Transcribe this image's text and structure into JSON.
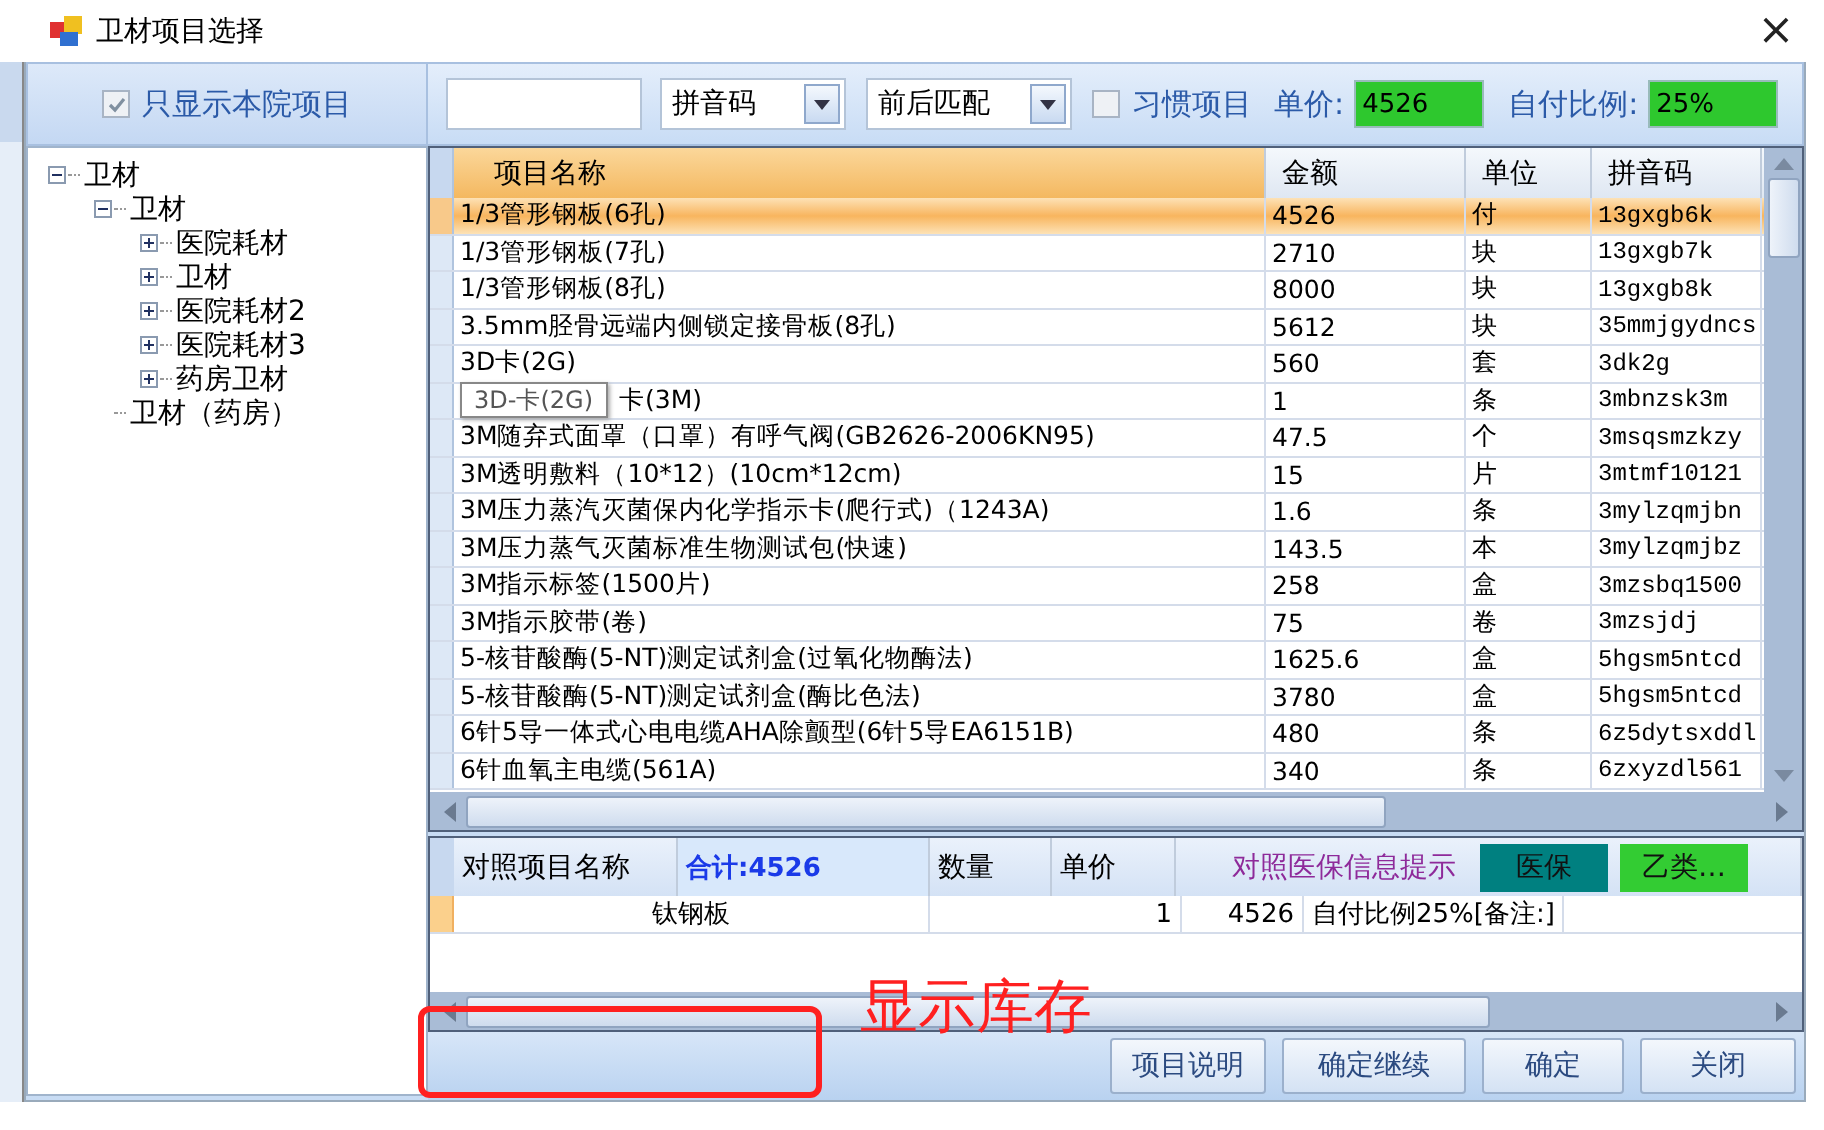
{
  "window": {
    "title": "卫材项目选择",
    "close": "×"
  },
  "filter": {
    "label": "只显示本院项目",
    "checked": true
  },
  "tree": [
    {
      "label": "卫材",
      "kind": "folder",
      "expanded": true,
      "children": [
        {
          "label": "卫材",
          "kind": "folder",
          "expanded": true,
          "children": [
            {
              "label": "医院耗材",
              "kind": "folder",
              "expanded": false
            },
            {
              "label": "卫材",
              "kind": "folder",
              "expanded": false
            },
            {
              "label": "医院耗材2",
              "kind": "folder",
              "expanded": false
            },
            {
              "label": "医院耗材3",
              "kind": "folder",
              "expanded": false
            },
            {
              "label": "药房卫材",
              "kind": "folder",
              "expanded": false
            }
          ]
        },
        {
          "label": "卫材（药房）",
          "kind": "leaf"
        }
      ]
    }
  ],
  "toolbar": {
    "search_mode": {
      "value": "拼音码"
    },
    "match_mode": {
      "value": "前后匹配"
    },
    "habit": {
      "label": "习惯项目",
      "checked": false
    },
    "price": {
      "label": "单价:",
      "value": "4526"
    },
    "ratio": {
      "label": "自付比例:",
      "value": "25%"
    }
  },
  "table": {
    "columns": [
      "项目名称",
      "金额",
      "单位",
      "拼音码"
    ],
    "rows": [
      {
        "cells": [
          "1/3管形钢板(6孔)",
          "4526",
          "付",
          "13gxgb6k"
        ],
        "selected": true
      },
      {
        "cells": [
          "1/3管形钢板(7孔)",
          "2710",
          "块",
          "13gxgb7k"
        ],
        "selected": false
      },
      {
        "cells": [
          "1/3管形钢板(8孔)",
          "8000",
          "块",
          "13gxgb8k"
        ],
        "selected": false
      },
      {
        "cells": [
          "3.5mm胫骨远端内侧锁定接骨板(8孔)",
          "5612",
          "块",
          "35mmjgydncs"
        ],
        "selected": false
      },
      {
        "cells": [
          "3D卡(2G)",
          "560",
          "套",
          "3dk2g"
        ],
        "selected": false
      },
      {
        "cells": [
          "卡(3M)",
          "1",
          "条",
          "3mbnzsk3m"
        ],
        "selected": false,
        "tooltip": "3D-卡(2G)"
      },
      {
        "cells": [
          "3M随弃式面罩（口罩）有呼气阀(GB2626-2006KN95)",
          "47.5",
          "个",
          "3msqsmzkzy"
        ],
        "selected": false
      },
      {
        "cells": [
          "3M透明敷料（10*12）(10cm*12cm)",
          "15",
          "片",
          "3mtmf10121"
        ],
        "selected": false
      },
      {
        "cells": [
          "3M压力蒸汽灭菌保内化学指示卡(爬行式)（1243A)",
          "1.6",
          "条",
          "3mylzqmjbn"
        ],
        "selected": false
      },
      {
        "cells": [
          "3M压力蒸气灭菌标准生物测试包(快速)",
          "143.5",
          "本",
          "3mylzqmjbz"
        ],
        "selected": false
      },
      {
        "cells": [
          "3M指示标签(1500片)",
          "258",
          "盒",
          "3mzsbq1500"
        ],
        "selected": false
      },
      {
        "cells": [
          "3M指示胶带(卷)",
          "75",
          "卷",
          "3mzsjdj"
        ],
        "selected": false
      },
      {
        "cells": [
          "5-核苷酸酶(5-NT)测定试剂盒(过氧化物酶法)",
          "1625.6",
          "盒",
          "5hgsm5ntcd"
        ],
        "selected": false
      },
      {
        "cells": [
          "5-核苷酸酶(5-NT)测定试剂盒(酶比色法)",
          "3780",
          "盒",
          "5hgsm5ntcd"
        ],
        "selected": false
      },
      {
        "cells": [
          "6针5导一体式心电电缆AHA除颤型(6针5导EA6151B)",
          "480",
          "条",
          "6z5dytsxddl"
        ],
        "selected": false
      },
      {
        "cells": [
          "6针血氧主电缆(561A)",
          "340",
          "条",
          "6zxyzdl561"
        ],
        "selected": false
      }
    ]
  },
  "compare": {
    "columns": [
      "对照项目名称",
      "合计:4526",
      "数量",
      "单价"
    ],
    "hint": "对照医保信息提示",
    "badges": [
      {
        "text": "医保",
        "color": "#008080"
      },
      {
        "text": "乙类…",
        "color": "#33cc33"
      }
    ],
    "rows": [
      {
        "cells": [
          "钛钢板",
          "1",
          "4526",
          "自付比例25%[备注:]"
        ]
      }
    ]
  },
  "buttons": [
    "项目说明",
    "确定继续",
    "确定",
    "关闭"
  ],
  "annotation": {
    "text": "显示库存"
  }
}
